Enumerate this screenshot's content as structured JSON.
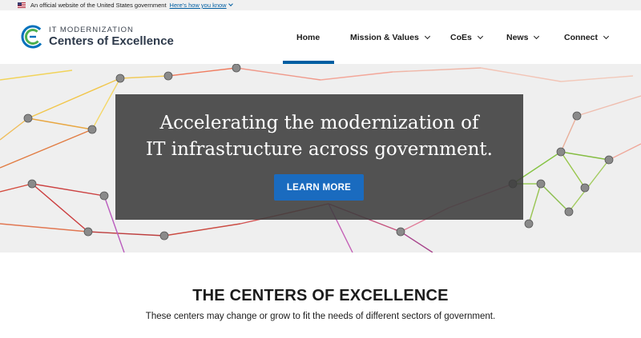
{
  "gov_banner": {
    "text": "An official website of the United States government",
    "link": "Here's how you know",
    "flag_icon": "us-flag-icon"
  },
  "header": {
    "logo_top": "IT MODERNIZATION",
    "logo_bottom": "Centers of Excellence",
    "logo_mark": "CE",
    "nav": [
      {
        "label": "Home",
        "active": true,
        "has_dropdown": false
      },
      {
        "label": "Mission & Values",
        "active": false,
        "has_dropdown": true
      },
      {
        "label": "CoEs",
        "active": false,
        "has_dropdown": true
      },
      {
        "label": "News",
        "active": false,
        "has_dropdown": true
      },
      {
        "label": "Connect",
        "active": false,
        "has_dropdown": true
      }
    ]
  },
  "hero": {
    "title_line1": "Accelerating the modernization of",
    "title_line2": "IT infrastructure across government.",
    "button": "LEARN MORE"
  },
  "section": {
    "title": "THE CENTERS OF EXCELLENCE",
    "subtitle": "These centers may change or grow to fit the needs of different sectors of government."
  },
  "colors": {
    "primary": "#005ea2",
    "button": "#1a6bbf",
    "logo_blue": "#0071bc",
    "logo_green": "#4caf50",
    "banner_bg": "#f0f0f0",
    "hero_box": "#3c3c3c"
  }
}
